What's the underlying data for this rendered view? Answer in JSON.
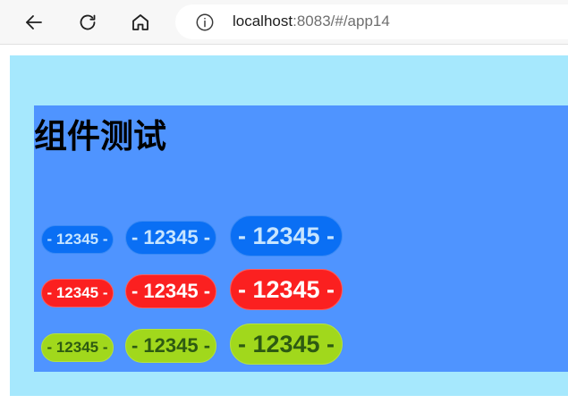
{
  "browser": {
    "url_host": "localhost",
    "url_rest": ":8083/#/app14",
    "icons": {
      "back": "arrow-left",
      "reload": "reload",
      "home": "home",
      "info": "info-circle"
    }
  },
  "page": {
    "title": "组件测试",
    "colors": {
      "outer_bg": "#a6e8fd",
      "panel_bg": "#4f94ff",
      "blue": "#0a6ff4",
      "red": "#fb2020",
      "green": "#a1d81c"
    },
    "rows": [
      {
        "color": "blue",
        "buttons": [
          {
            "label": "- 12345 -",
            "size": "small"
          },
          {
            "label": "- 12345 -",
            "size": "medium"
          },
          {
            "label": "- 12345 -",
            "size": "large"
          }
        ]
      },
      {
        "color": "red",
        "buttons": [
          {
            "label": "- 12345 -",
            "size": "small"
          },
          {
            "label": "- 12345 -",
            "size": "medium"
          },
          {
            "label": "- 12345 -",
            "size": "large"
          }
        ]
      },
      {
        "color": "green",
        "buttons": [
          {
            "label": "- 12345 -",
            "size": "small"
          },
          {
            "label": "- 12345 -",
            "size": "medium"
          },
          {
            "label": "- 12345 -",
            "size": "large"
          }
        ]
      }
    ]
  }
}
